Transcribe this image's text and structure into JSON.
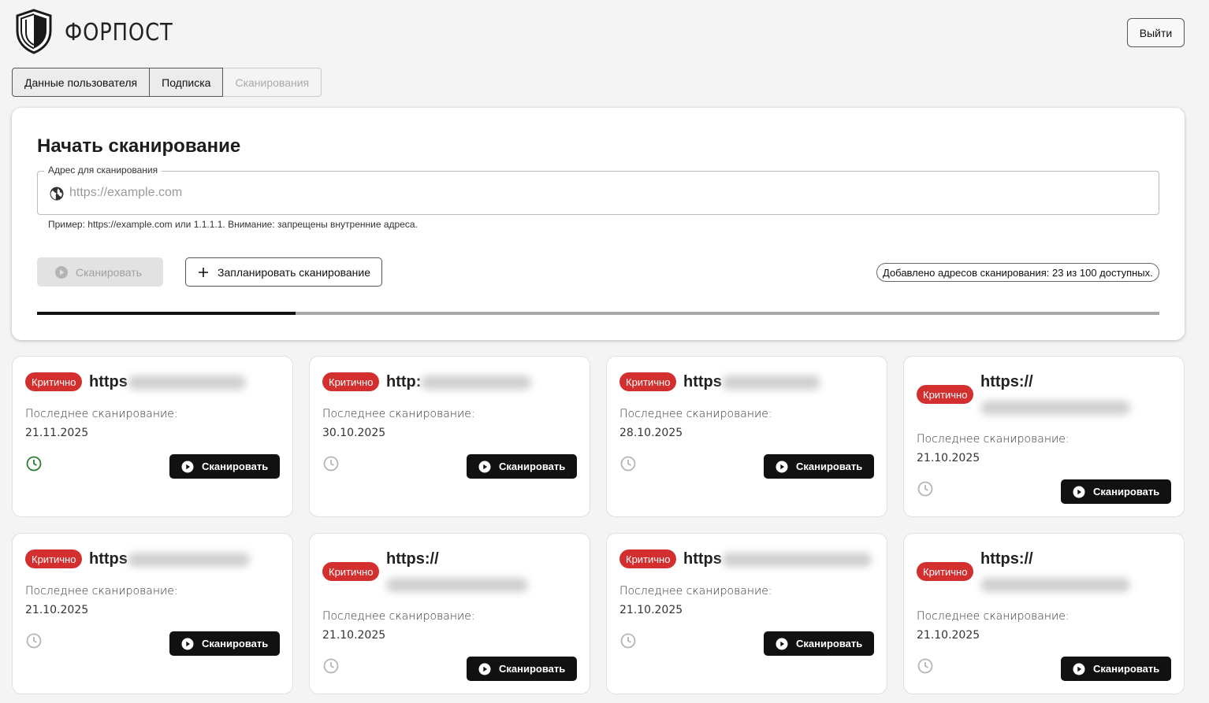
{
  "app": {
    "logo_text": "ФОРПОСТ",
    "logout_label": "Выйти"
  },
  "tabs": [
    {
      "label": "Данные пользователя",
      "disabled": false
    },
    {
      "label": "Подписка",
      "disabled": false
    },
    {
      "label": "Сканирования",
      "disabled": true
    }
  ],
  "scan_form": {
    "title": "Начать сканирование",
    "field_label": "Адрес для сканирования",
    "placeholder": "https://example.com",
    "value": "",
    "helper": "Пример: https://example.com или 1.1.1.1. Внимание: запрещены внутренние адреса.",
    "scan_label": "Сканировать",
    "schedule_label": "Запланировать сканирование",
    "quota_text": "Добавлено адресов сканирования: 23 из 100 доступных.",
    "quota_used": 23,
    "quota_total": 100
  },
  "card_common": {
    "badge": "Критично",
    "last_scan_label": "Последнее сканирование:",
    "scan_label": "Сканировать"
  },
  "cards": [
    {
      "url": "https",
      "date": "21.11.2025",
      "clock_active": true
    },
    {
      "url": "http:",
      "date": "30.10.2025",
      "clock_active": false
    },
    {
      "url": "https",
      "date": "28.10.2025",
      "clock_active": false
    },
    {
      "url": "https://",
      "date": "21.10.2025",
      "clock_active": false
    },
    {
      "url": "https",
      "date": "21.10.2025",
      "clock_active": false
    },
    {
      "url": "https://",
      "date": "21.10.2025",
      "clock_active": false
    },
    {
      "url": "https",
      "date": "21.10.2025",
      "clock_active": false
    },
    {
      "url": "https://",
      "date": "21.10.2025",
      "clock_active": false
    }
  ],
  "colors": {
    "critical": "#d32f2f",
    "active_clock": "#2e7d32",
    "inactive_clock": "#b5b5b5",
    "primary": "#111111"
  },
  "icons": {
    "logo": "shield-icon",
    "field": "globe-icon",
    "scan": "play-circle-icon",
    "schedule": "plus-icon",
    "card_status": "clock-icon"
  }
}
